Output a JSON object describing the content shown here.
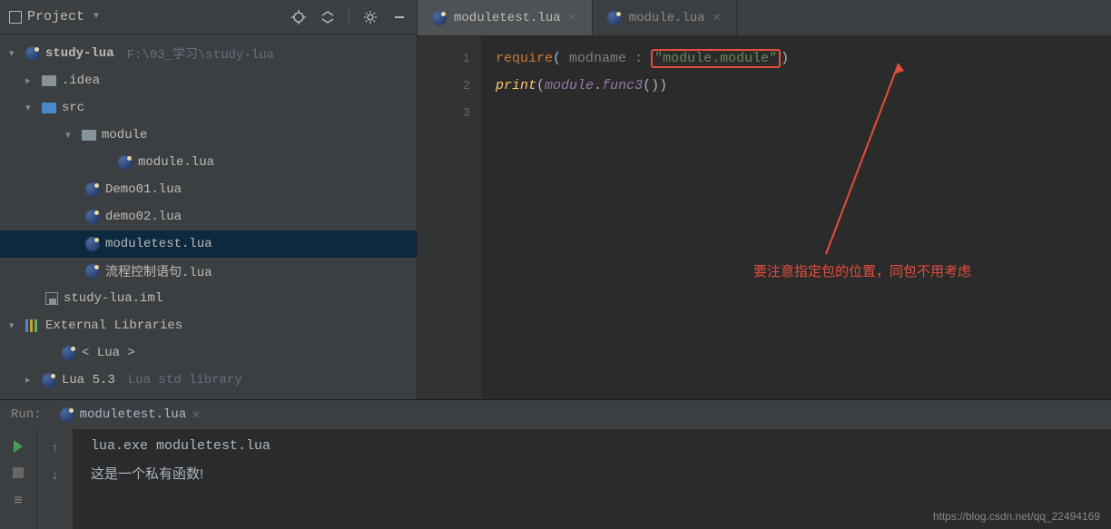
{
  "sidebar": {
    "title": "Project",
    "root": {
      "name": "study-lua",
      "path": "F:\\03_学习\\study-lua"
    },
    "tree": {
      "idea": ".idea",
      "src": "src",
      "module_folder": "module",
      "module_file": "module.lua",
      "demo01": "Demo01.lua",
      "demo02": "demo02.lua",
      "moduletest": "moduletest.lua",
      "flowcontrol": "流程控制语句.lua",
      "iml": "study-lua.iml",
      "external_libs": "External Libraries",
      "lua_lib": "< Lua >",
      "lua53": "Lua 5.3",
      "lua_std": "Lua std library"
    }
  },
  "editor": {
    "tabs": {
      "active": "moduletest.lua",
      "inactive": "module.lua"
    },
    "code": {
      "require_kw": "require",
      "modname_label": "modname :",
      "module_string": "\"module.module\"",
      "print_fn": "print",
      "module_ref": "module",
      "func_ref": "func3"
    },
    "line_numbers": [
      "1",
      "2",
      "3"
    ]
  },
  "annotation": {
    "text": "要注意指定包的位置，同包不用考虑"
  },
  "run": {
    "label": "Run:",
    "tab": "moduletest.lua",
    "command": "lua.exe moduletest.lua",
    "output": "这是一个私有函数!"
  },
  "watermark": "https://blog.csdn.net/qq_22494169"
}
